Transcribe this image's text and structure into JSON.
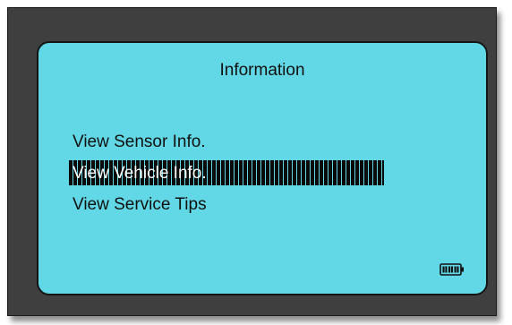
{
  "screen": {
    "title": "Information",
    "menu": [
      {
        "label": "View Sensor Info.",
        "selected": false
      },
      {
        "label": "View Vehicle Info.",
        "selected": true
      },
      {
        "label": "View Service Tips",
        "selected": false
      }
    ],
    "battery_icon": "battery-full-icon"
  },
  "colors": {
    "device_frame": "#3f3f3f",
    "screen_background": "#62d8e6",
    "selection_bar": "#0a0a0a",
    "text": "#111111",
    "selected_text": "#ffffff"
  }
}
